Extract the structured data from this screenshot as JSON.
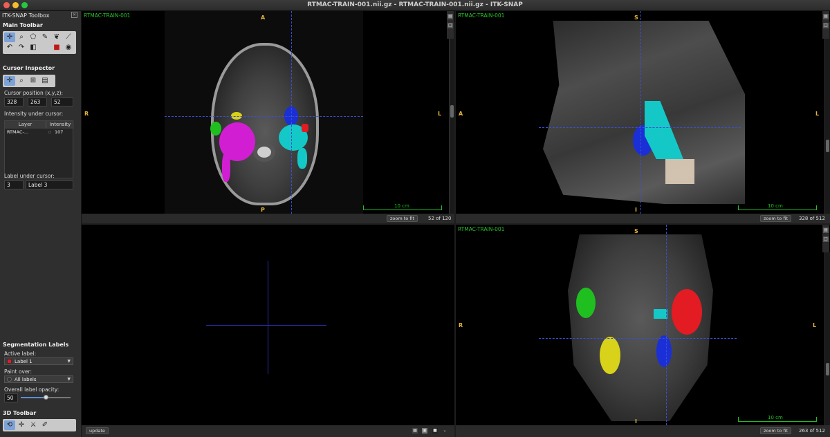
{
  "window": {
    "title": "RTMAC-TRAIN-001.nii.gz - RTMAC-TRAIN-001.nii.gz - ITK-SNAP"
  },
  "toolbox": {
    "title": "ITK-SNAP Toolbox",
    "main_toolbar": "Main Toolbar",
    "cursor_inspector": "Cursor Inspector",
    "cursor_position_label": "Cursor position (x,y,z):",
    "cursor_x": "328",
    "cursor_y": "263",
    "cursor_z": "52",
    "intensity_label": "Intensity under cursor:",
    "table": {
      "col_layer": "Layer",
      "col_intensity": "Intensity",
      "row_layer": "RTMAC-...",
      "row_intensity": "107"
    },
    "label_under_cursor": "Label under cursor:",
    "label_id": "3",
    "label_name": "Label 3",
    "segmentation_labels": "Segmentation Labels",
    "active_label_caption": "Active label:",
    "active_label": "Label 1",
    "paint_over_caption": "Paint over:",
    "paint_over": "All labels",
    "opacity_caption": "Overall label opacity:",
    "opacity_value": "50",
    "opacity_fraction": 0.5,
    "toolbar_3d": "3D Toolbar"
  },
  "views": {
    "axial": {
      "name": "RTMAC-TRAIN-001",
      "top": "A",
      "bottom": "P",
      "left": "R",
      "right": "L",
      "scale": "10 cm",
      "zoom": "zoom to fit",
      "slice": "52 of 120"
    },
    "sagittal": {
      "name": "RTMAC-TRAIN-001",
      "top": "S",
      "bottom": "I",
      "left": "A",
      "right": "L",
      "scale": "10 cm",
      "zoom": "zoom to fit",
      "slice": "328 of 512"
    },
    "coronal": {
      "name": "RTMAC-TRAIN-001",
      "top": "S",
      "bottom": "I",
      "left": "R",
      "right": "L",
      "scale": "10 cm",
      "zoom": "zoom to fit",
      "slice": "263 of 512"
    },
    "render3d": {
      "update": "update"
    }
  },
  "colors": {
    "label_red": "#e31b23",
    "label_green": "#1fbf1f",
    "label_blue": "#1b2fd6",
    "label_yellow": "#d8d21a",
    "label_magenta": "#d21ed2",
    "label_cyan": "#14c8c8",
    "label_beige": "#e8d6c0",
    "orientation_letters": "#e6b43c",
    "layer_name": "#29c129"
  }
}
